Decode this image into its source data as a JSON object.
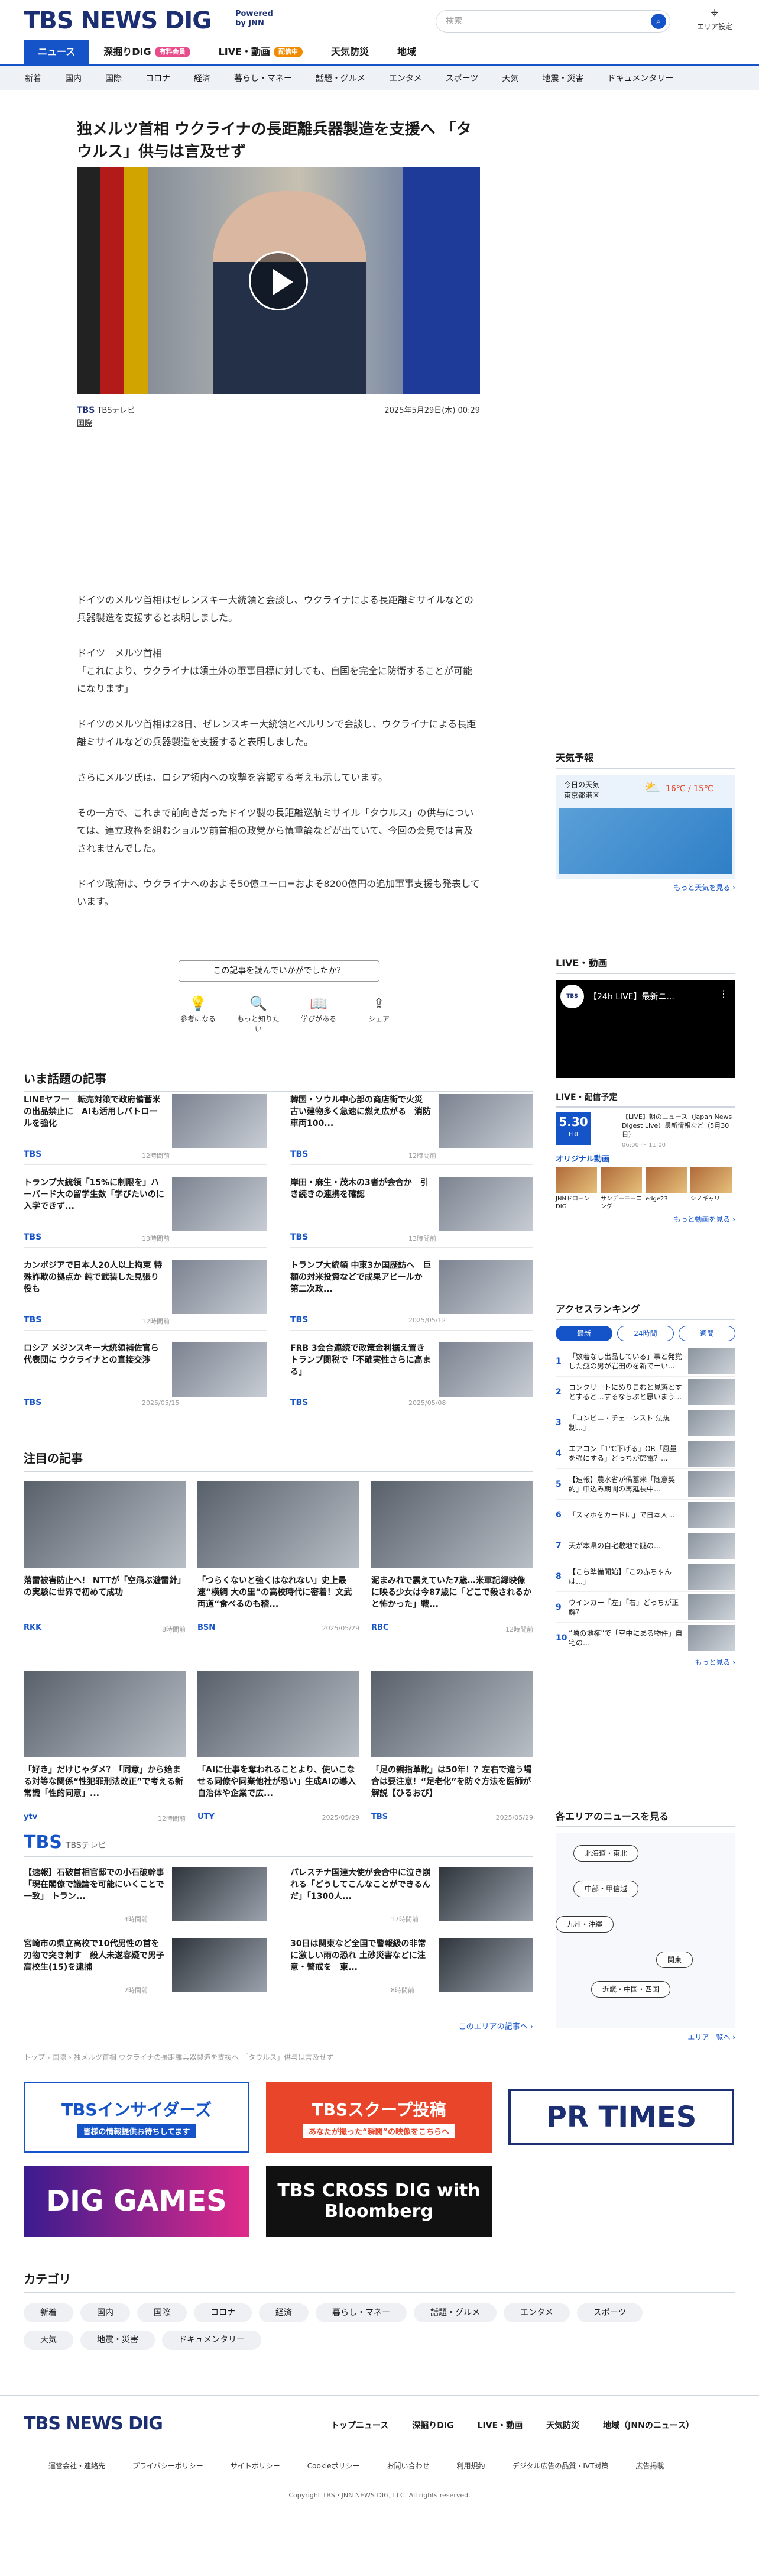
{
  "header": {
    "logo": "TBS NEWS DIG",
    "logo_sub": "Powered by JNN",
    "search_placeholder": "検索",
    "region_label": "エリア設定"
  },
  "gnav": [
    {
      "label": "ニュース",
      "on": true
    },
    {
      "label": "深掘りDIG",
      "badge": "有料会員"
    },
    {
      "label": "LIVE・動画",
      "badge": "配信中"
    },
    {
      "label": "天気防災"
    },
    {
      "label": "地域"
    }
  ],
  "categories": [
    "新着",
    "国内",
    "国際",
    "コロナ",
    "経済",
    "暮らし・マネー",
    "話題・グルメ",
    "エンタメ",
    "スポーツ",
    "天気",
    "地震・災害",
    "ドキュメンタリー"
  ],
  "article": {
    "title": "独メルツ首相 ウクライナの長距離兵器製造を支援へ 「タウルス」供与は言及せず",
    "source": "TBSテレビ",
    "date": "2025年5月29日(木) 00:29",
    "tag": "国際",
    "body": [
      "ドイツのメルツ首相はゼレンスキー大統領と会談し、ウクライナによる長距離ミサイルなどの兵器製造を支援すると表明しました。",
      "ドイツ　メルツ首相\n「これにより、ウクライナは領土外の軍事目標に対しても、自国を完全に防衛することが可能になります」",
      "ドイツのメルツ首相は28日、ゼレンスキー大統領とベルリンで会談し、ウクライナによる長距離ミサイルなどの兵器製造を支援すると表明しました。",
      "さらにメルツ氏は、ロシア領内への攻撃を容認する考えも示しています。",
      "その一方で、これまで前向きだったドイツ製の長距離巡航ミサイル「タウルス」の供与については、連立政権を組むショルツ前首相の政党から慎重論などが出ていて、今回の会見では言及されませんでした。",
      "ドイツ政府は、ウクライナへのおよそ50億ユーロ=およそ8200億円の追加軍事支援も発表しています。"
    ],
    "feedback": "この記事を読んでいかがでしたか？",
    "reactions": [
      {
        "icon": "💡",
        "label": "参考になる"
      },
      {
        "icon": "🔍",
        "label": "もっと知りたい"
      },
      {
        "icon": "📖",
        "label": "学びがある"
      },
      {
        "icon": "⇪",
        "label": "シェア"
      }
    ]
  },
  "hot": {
    "title": "いま話題の記事",
    "items": [
      {
        "t": "LINEヤフー　転売対策で政府備蓄米の出品禁止に　AIも活用しパトロールを強化",
        "s": "TBS",
        "d": "12時間前"
      },
      {
        "t": "韓国・ソウル中心部の商店街で火災　古い建物多く急速に燃え広がる　消防車両100...",
        "s": "TBS",
        "d": "12時間前"
      },
      {
        "t": "トランプ大統領「15%に制限を」ハーバード大の留学生数「学びたいのに入学できず...",
        "s": "TBS",
        "d": "13時間前"
      },
      {
        "t": "岸田・麻生・茂木の3者が会合か　引き続きの連携を確認",
        "s": "TBS",
        "d": "13時間前"
      },
      {
        "t": "カンボジアで日本人20人以上拘束 特殊詐欺の拠点か 鈍で武装した見張り役も",
        "s": "TBS",
        "d": "12時間前"
      },
      {
        "t": "トランプ大統領 中東3か国歴訪へ　巨額の対米投資などで成果アピールか　第二次政...",
        "s": "TBS",
        "d": "2025/05/12"
      },
      {
        "t": "ロシア メジンスキー大統領補佐官ら代表団に ウクライナとの直接交渉",
        "s": "TBS",
        "d": "2025/05/15"
      },
      {
        "t": "FRB 3会合連続で政策金利据え置き トランプ関税で「不確実性さらに高まる」",
        "s": "TBS",
        "d": "2025/05/08"
      }
    ]
  },
  "featured": {
    "title": "注目の記事",
    "items": [
      {
        "t": "落雷被害防止へ！ NTTが「空飛ぶ避雷針」の実験に世界で初めて成功",
        "s": "RKK",
        "d": "8時間前"
      },
      {
        "t": "「つらくないと強くはなれない」史上最速“横綱 大の里”の高校時代に密着！文武両道“食べるのも稽...",
        "s": "BSN",
        "d": "2025/05/29"
      },
      {
        "t": "泥まみれで震えていた7歳…米軍記録映像に映る少女は今87歳に「どこで殺されるかと怖かった」戦...",
        "s": "RBC",
        "d": "12時間前"
      },
      {
        "t": "「好き」だけじゃダメ？「同意」から始まる対等な関係“性犯罪刑法改正”で考える新常識「性的同意」...",
        "s": "ytv",
        "d": "12時間前"
      },
      {
        "t": "「AIに仕事を奪われることより、使いこなせる同僚や同業他社が恐い」生成AIの導入　自治体や企業で広...",
        "s": "UTY",
        "d": "2025/05/29"
      },
      {
        "t": "「足の親指革靴」は50年！？左右で違う場合は要注意！“足老化”を防ぐ方法を医師が解説【ひるおび】",
        "s": "TBS",
        "d": "2025/05/29"
      }
    ]
  },
  "tbs_block": {
    "title": "TBS",
    "sub": "TBSテレビ",
    "items": [
      {
        "t": "【速報】石破首相官邸での小石破幹事「現在閣僚で議論を可能にいくことで一致」 トラン...",
        "d": "4時間前"
      },
      {
        "t": "パレスチナ国連大使が会合中に泣き崩れる「どうしてこんなことができるんだ」「1300人...",
        "d": "17時間前"
      },
      {
        "t": "宮崎市の県立高校で10代男性の首を刃物で突き刺す　殺人未遂容疑で男子高校生(15)を逮捕",
        "d": "2時間前"
      },
      {
        "t": "30日は関東など全国で警報級の非常に激しい雨の恐れ 土砂災害などに注意・警戒を　東...",
        "d": "8時間前"
      }
    ],
    "more": "このエリアの記事へ ›"
  },
  "breadcrumb": "トップ › 国際 › 独メルツ首相 ウクライナの長距離兵器製造を支援へ 「タウルス」供与は言及せず",
  "banners": [
    "TBSインサイダーズ",
    "TBSスクープ投稿",
    "PR TIMES",
    "DIG GAMES",
    "TBS CROSS DIG with Bloomberg"
  ],
  "banner_subs": [
    "皆様の情報提供お待ちしてます",
    "あなたが撮った“瞬間”の映像をこちらへ"
  ],
  "category_title": "カテゴリ",
  "footer": {
    "logo": "TBS NEWS DIG",
    "nav": [
      "トップニュース",
      "深掘りDIG",
      "LIVE・動画",
      "天気防災",
      "地域（JNNのニュース）"
    ],
    "sub": [
      "運営会社・連絡先",
      "プライバシーポリシー",
      "サイトポリシー",
      "Cookieポリシー",
      "お問い合わせ",
      "利用規約",
      "デジタル広告の品質・IVT対策",
      "広告掲載"
    ],
    "copy": "Copyright TBS・JNN NEWS DIG, LLC. All rights reserved."
  },
  "sidebar": {
    "weather_title": "天気予報",
    "today": "今日の天気",
    "area": "東京都港区",
    "temp": "16℃ / 15℃",
    "weather_more": "もっと天気を見る ›",
    "live_title": "LIVE・動画",
    "live_video": "【24h LIVE】最新ニ...",
    "schedule_title": "LIVE・配信予定",
    "schedule_date": "5.30",
    "schedule_day": "FRI",
    "schedule_text": "【LIVE】朝のニュース（Japan News Digest Live）最新情報など（5月30日）",
    "schedule_time": "06:00 ～ 11:00",
    "original_title": "オリジナル動画",
    "originals": [
      "JNNドローンDIG",
      "サンデーモーニング",
      "edge23",
      "シノギャリ"
    ],
    "video_more": "もっと動画を見る ›",
    "ranking_title": "アクセスランキング",
    "ranking_tabs": [
      "最新",
      "24時間",
      "週間"
    ],
    "ranking": [
      "「数着なし出品している」事と発覚した謎の男が岩田のを新でーい...",
      "コンクリートにめりこむと見落とすとすると…するならぶと思いまう...",
      "「コンビニ・チェーンスト 法規制…」",
      "エアコン「1℃下げる」OR「風量を強にする」どっちが節電？...",
      "【速報】農水省が備蓄米「随意契約」申込み期間の再延長中…",
      "「スマホをカードに」で日本人…",
      "天が本県の自宅敷地で謎の…",
      "【こら準備開始】「この赤ちゃんは…」",
      "ウインカー「左」「右」どっちが正解？",
      "“隣の地権”で「空中にある物件」自宅の…"
    ],
    "ranking_more": "もっと見る ›",
    "area_title": "各エリアのニュースを見る",
    "areas": [
      "北海道・東北",
      "中部・甲信越",
      "九州・沖縄",
      "関東",
      "近畿・中国・四国"
    ],
    "area_more": "エリア一覧へ ›"
  }
}
